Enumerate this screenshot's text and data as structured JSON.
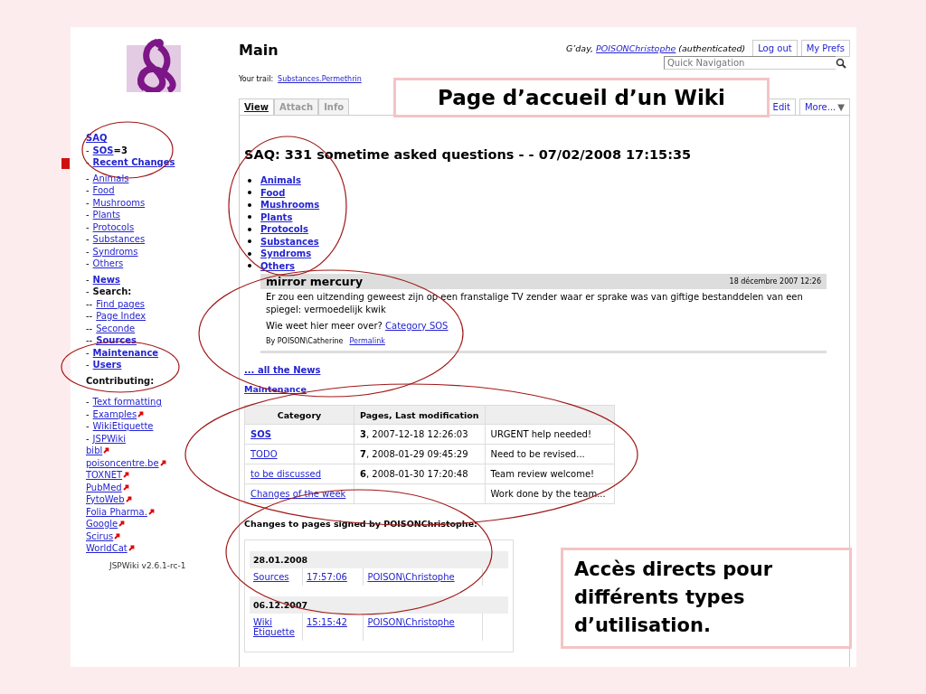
{
  "callouts": [
    {
      "text": "Page d’accueil d’un Wiki"
    },
    {
      "text": "Accès directs pour différents types d’utilisation."
    }
  ],
  "header": {
    "title": "Main",
    "greeting": "G’day,",
    "user": "POISONChristophe",
    "status": "(authenticated)",
    "buttons": [
      "Log out",
      "My Prefs"
    ],
    "search": {
      "placeholder": "Quick Navigation"
    },
    "trail_label": "Your trail:",
    "trail": [
      "Substances.Permethrin"
    ]
  },
  "tabs": [
    {
      "label": "View",
      "selected": true,
      "disabled": false
    },
    {
      "label": "Attach",
      "selected": false,
      "disabled": true
    },
    {
      "label": "Info",
      "selected": false,
      "disabled": true
    }
  ],
  "actions": [
    {
      "label": "Edit"
    },
    {
      "label": "More...",
      "caret": "▼"
    }
  ],
  "sidebar": {
    "sections": [
      {
        "items": [
          {
            "label": "SAQ",
            "kind": "bold-link",
            "external": false
          },
          {
            "prefix": "-",
            "label": "SOS",
            "suffix": "=3",
            "kind": "bold-link",
            "external": false
          },
          {
            "prefix": "-",
            "label": "Recent Changes",
            "kind": "bold-link",
            "external": false
          }
        ]
      },
      {
        "items": [
          {
            "prefix": "-",
            "label": "Animals",
            "kind": "link",
            "external": false
          },
          {
            "prefix": "-",
            "label": "Food",
            "kind": "link",
            "external": false
          },
          {
            "prefix": "-",
            "label": "Mushrooms",
            "kind": "link",
            "external": false
          },
          {
            "prefix": "-",
            "label": "Plants",
            "kind": "link",
            "external": false
          },
          {
            "prefix": "-",
            "label": "Protocols",
            "kind": "link",
            "external": false
          },
          {
            "prefix": "-",
            "label": "Substances",
            "kind": "link",
            "external": false
          },
          {
            "prefix": "-",
            "label": "Syndroms",
            "kind": "link",
            "external": false
          },
          {
            "prefix": "-",
            "label": "Others",
            "kind": "link",
            "external": false
          }
        ]
      },
      {
        "items": [
          {
            "prefix": "-",
            "label": "News",
            "kind": "bold-link",
            "external": false
          },
          {
            "prefix": "-",
            "label": "Search:",
            "kind": "label",
            "external": false
          },
          {
            "prefix": "--",
            "label": "Find pages",
            "kind": "link",
            "external": false
          },
          {
            "prefix": "--",
            "label": "Page Index",
            "kind": "link",
            "external": false
          },
          {
            "prefix": "--",
            "label": "Seconde",
            "kind": "link",
            "external": false
          },
          {
            "prefix": "--",
            "label": "Sources",
            "kind": "bold-link",
            "external": false
          },
          {
            "prefix": "-",
            "label": "Maintenance",
            "kind": "bold-link",
            "external": false
          },
          {
            "prefix": "-",
            "label": "Users",
            "kind": "bold-link",
            "external": false
          }
        ]
      },
      {
        "items": [
          {
            "label": "Contributing:",
            "kind": "label",
            "external": false
          }
        ]
      },
      {
        "items": [
          {
            "prefix": "-",
            "label": "Text formatting",
            "kind": "link",
            "external": false
          },
          {
            "prefix": "-",
            "label": "Examples",
            "kind": "link",
            "external": true
          },
          {
            "prefix": "-",
            "label": "WikiEtiquette",
            "kind": "link",
            "external": false
          },
          {
            "prefix": "-",
            "label": "JSPWiki",
            "kind": "link",
            "external": false
          },
          {
            "label": "bibl",
            "kind": "link",
            "external": true
          },
          {
            "label": "poisoncentre.be",
            "kind": "link",
            "external": true
          },
          {
            "label": "TOXNET",
            "kind": "link",
            "external": true
          },
          {
            "label": "PubMed",
            "kind": "link",
            "external": true
          },
          {
            "label": "FytoWeb",
            "kind": "link",
            "external": true
          },
          {
            "label": "Folia Pharma.",
            "kind": "link",
            "external": true
          },
          {
            "label": "Google",
            "kind": "link",
            "external": true
          },
          {
            "label": "Scirus",
            "kind": "link",
            "external": true
          },
          {
            "label": "WorldCat",
            "kind": "link",
            "external": true
          }
        ]
      }
    ],
    "version": "JSPWiki v2.6.1-rc-1"
  },
  "content": {
    "heading": "SAQ: 331 sometime asked questions - - 07/02/2008 17:15:35",
    "categories": [
      "Animals",
      "Food",
      "Mushrooms",
      "Plants",
      "Protocols",
      "Substances",
      "Syndroms",
      "Others"
    ],
    "news": {
      "title": "mirror mercury",
      "date": "18 décembre 2007 12:26",
      "text": "Er zou een uitzending geweest zijn op een franstalige TV zender waar er sprake was van giftige bestanddelen van een spiegel: vermoedelijk kwik",
      "question": "Wie weet hier meer over?",
      "link": "Category SOS",
      "byline": "By POISON\\Catherine",
      "permalink": "Permalink"
    },
    "all_news": "... all the News",
    "maintenance_link": "Maintenance",
    "table": {
      "columns": [
        "Category",
        "Pages, Last modification"
      ],
      "rows": [
        {
          "category": "SOS",
          "bold": true,
          "pages": "**3**, 2007-12-18 12:26:03",
          "note": "URGENT help needed!"
        },
        {
          "category": "TODO",
          "bold": false,
          "pages": "**7**, 2008-01-29 09:45:29",
          "note": "Need to be revised..."
        },
        {
          "category": "to be discussed",
          "bold": false,
          "pages": "**6**, 2008-01-30 17:20:48",
          "note": "Team review welcome!"
        },
        {
          "category": "Changes of the week",
          "bold": false,
          "note": "Work done by the team..."
        }
      ]
    },
    "changes_title": "Changes to pages signed by POISONChristophe:",
    "changes": [
      {
        "date": "28.01.2008",
        "rows": [
          [
            "Sources",
            "17:57:06",
            "POISON\\Christophe"
          ]
        ]
      },
      {
        "date": "06.12.2007",
        "rows": [
          [
            "Wiki Etiquette",
            "15:15:42",
            "POISON\\Christophe"
          ]
        ]
      }
    ]
  }
}
